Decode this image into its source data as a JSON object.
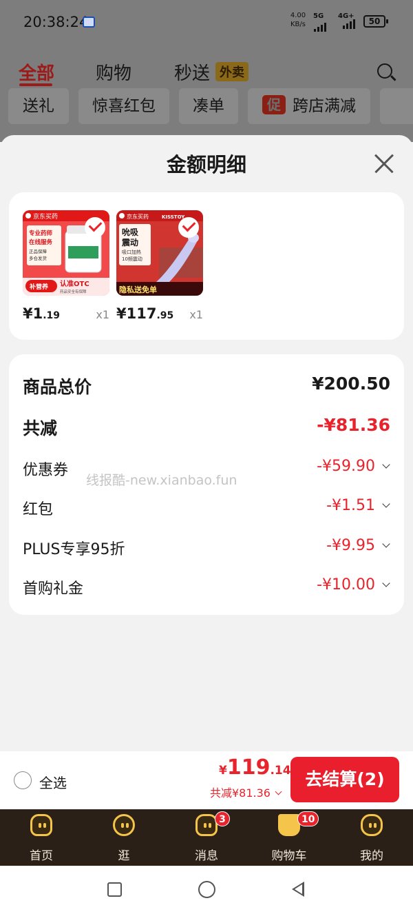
{
  "status_bar": {
    "time": "20:38:24",
    "net_speed_value": "4.00",
    "net_speed_unit": "KB/s",
    "net_1": "5G",
    "net_2": "4G+",
    "battery": "50"
  },
  "background_page": {
    "tabs": [
      {
        "label": "全部"
      },
      {
        "label": "购物"
      },
      {
        "label": "秒送"
      }
    ],
    "tab_badge": "外卖",
    "chips": [
      {
        "label": "送礼"
      },
      {
        "label": "惊喜红包"
      },
      {
        "label": "凑单"
      },
      {
        "label": "跨店满减",
        "promo_icon": "促"
      }
    ]
  },
  "sheet": {
    "title": "金额明细",
    "products": [
      {
        "price_int": "¥1",
        "price_dec": ".19",
        "qty": "x1",
        "image": {
          "brand": "京东买药",
          "line1": "专业药师",
          "line2": "在线服务",
          "tag1": "正品保障",
          "tag2": "多仓发货",
          "strip": "补营养",
          "strip_tag": "认准OTC",
          "strip_sub": "药品安全有保障"
        }
      },
      {
        "price_int": "¥117",
        "price_dec": ".95",
        "qty": "x1",
        "image": {
          "brand": "京东买药",
          "brand2": "KISSTOY",
          "line1": "吮吸",
          "line2": "震动",
          "line3": "吸口加热",
          "line4": "10频震动",
          "strip": "隐私送免单"
        }
      }
    ],
    "summary": {
      "total": {
        "label": "商品总价",
        "value": "¥200.50"
      },
      "discount": {
        "label": "共减",
        "value": "-¥81.36"
      },
      "details": [
        {
          "label": "优惠券",
          "value": "-¥59.90"
        },
        {
          "label": "红包",
          "value": "-¥1.51"
        },
        {
          "label": "PLUS专享95折",
          "value": "-¥9.95"
        },
        {
          "label": "首购礼金",
          "value": "-¥10.00"
        }
      ]
    },
    "watermark": "线报酷-new.xianbao.fun"
  },
  "checkout": {
    "select_all": "全选",
    "currency": "¥",
    "price_int": "119",
    "price_dec": ".14",
    "discount_line": "共减¥81.36",
    "button_label": "去结算(2)"
  },
  "bottom_nav": {
    "items": [
      {
        "label": "首页"
      },
      {
        "label": "逛"
      },
      {
        "label": "消息",
        "badge": "3"
      },
      {
        "label": "购物车",
        "badge": "10"
      },
      {
        "label": "我的"
      }
    ]
  },
  "colors": {
    "accent_red": "#e8232c",
    "nav_bg": "#2b2018",
    "nav_icon": "#f5c44a"
  }
}
